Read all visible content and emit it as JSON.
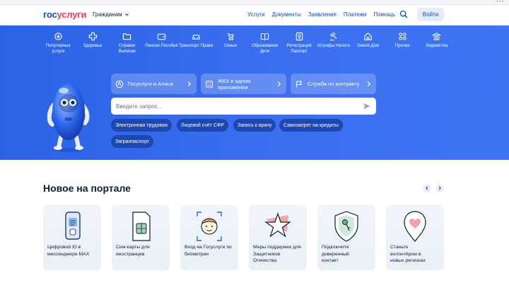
{
  "header": {
    "logo_part1": "гос",
    "logo_part2": "услуги",
    "audience": "Гражданам",
    "nav": [
      "Услуги",
      "Документы",
      "Заявления",
      "Платежи",
      "Помощь"
    ],
    "login": "Войти"
  },
  "categories": [
    {
      "label": "Популярные услуги",
      "icon": "popular-icon"
    },
    {
      "label": "Здоровье",
      "icon": "health-cross-icon"
    },
    {
      "label": "Справки Выписки",
      "icon": "folder-icon"
    },
    {
      "label": "Пенсии Пособия",
      "icon": "wallet-icon"
    },
    {
      "label": "Транспорт Права",
      "icon": "car-icon"
    },
    {
      "label": "Семья",
      "icon": "stroller-icon"
    },
    {
      "label": "Образование Дети",
      "icon": "book-icon"
    },
    {
      "label": "Регистрация Паспорт",
      "icon": "passport-icon"
    },
    {
      "label": "Штрафы Налоги",
      "icon": "gavel-icon"
    },
    {
      "label": "Земля Дом",
      "icon": "house-icon"
    },
    {
      "label": "Прочее",
      "icon": "grid-icon"
    },
    {
      "label": "Ведомства",
      "icon": "building-icon"
    }
  ],
  "quick_buttons": [
    {
      "label": "Госуслуги и Алиса",
      "icon": "alice-icon"
    },
    {
      "label": "ЖКХ в одном приложении",
      "icon": "utilities-icon"
    },
    {
      "label": "Служба по контракту",
      "icon": "flag-icon"
    }
  ],
  "search": {
    "placeholder": "Введите запрос..."
  },
  "chips": [
    "Электронная трудовая",
    "Лицевой счёт СФР",
    "Запись к врачу",
    "Самозапрет на кредиты",
    "Загранпаспорт"
  ],
  "new_section": {
    "title": "Новое на портале",
    "cards": [
      {
        "text": "Цифровой ID в мессенджере MAX",
        "icon": "phone-id-icon"
      },
      {
        "text": "Сим-карты для иностранцев",
        "icon": "sim-card-icon"
      },
      {
        "text": "Вход на Госуслуги по биометрии",
        "icon": "face-scan-icon"
      },
      {
        "text": "Меры поддержки для Защитников Отечества",
        "icon": "star-icon"
      },
      {
        "text": "Подключите доверенный контакт",
        "icon": "shield-key-icon"
      },
      {
        "text": "Станьте волонтёром в новых регионах",
        "icon": "heart-pin-icon"
      }
    ]
  },
  "colors": {
    "brand_blue": "#0d4cd3",
    "brand_red": "#ee3f58",
    "hero_blue": "#3a6ff0",
    "chip_blue": "#1d47b3"
  }
}
